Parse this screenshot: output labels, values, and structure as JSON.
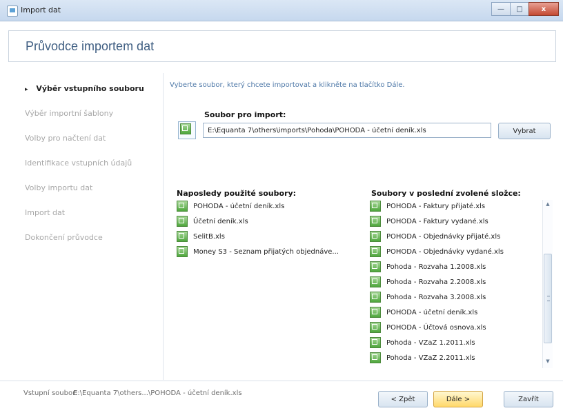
{
  "window": {
    "title": "Import dat",
    "buttons": {
      "minimize": "—",
      "maximize": "□",
      "close": "x"
    }
  },
  "header": {
    "title": "Průvodce importem dat"
  },
  "sidebar": {
    "steps": [
      {
        "label": "Výběr vstupního souboru",
        "active": true
      },
      {
        "label": "Výběr importní šablony",
        "active": false
      },
      {
        "label": "Volby pro načtení dat",
        "active": false
      },
      {
        "label": "Identifikace vstupních údajů",
        "active": false
      },
      {
        "label": "Volby importu dat",
        "active": false
      },
      {
        "label": "Import dat",
        "active": false
      },
      {
        "label": "Dokončení průvodce",
        "active": false
      }
    ],
    "active_marker": "▸"
  },
  "main": {
    "instruction": "Vyberte soubor, který chcete importovat a klikněte na tlačítko Dále.",
    "file_label": "Soubor pro import:",
    "file_path": "E:\\Equanta 7\\others\\imports\\Pohoda\\POHODA - účetní deník.xls",
    "select_button": "Vybrat",
    "recent_label": "Naposledy použité soubory:",
    "recent_files": [
      "POHODA - účetní deník.xls",
      "Účetní deník.xls",
      "SelitB.xls",
      "Money S3 - Seznam přijatých objednáve..."
    ],
    "folder_label": "Soubory v poslední zvolené složce:",
    "folder_files": [
      "POHODA - Faktury přijaté.xls",
      "POHODA - Faktury vydané.xls",
      "POHODA - Objednávky přijaté.xls",
      "POHODA - Objednávky vydané.xls",
      "Pohoda - Rozvaha 1.2008.xls",
      "Pohoda - Rozvaha 2.2008.xls",
      "Pohoda - Rozvaha 3.2008.xls",
      "POHODA - účetní deník.xls",
      "POHODA - Účtová osnova.xls",
      "Pohoda - VZaZ 1.2011.xls",
      "Pohoda - VZaZ 2.2011.xls"
    ]
  },
  "footer": {
    "input_label": "Vstupní soubor:",
    "input_value": "E:\\Equanta 7\\others...\\POHODA - účetní deník.xls",
    "back_button": "< Zpět",
    "next_button": "Dále >",
    "close_button": "Zavřít"
  }
}
